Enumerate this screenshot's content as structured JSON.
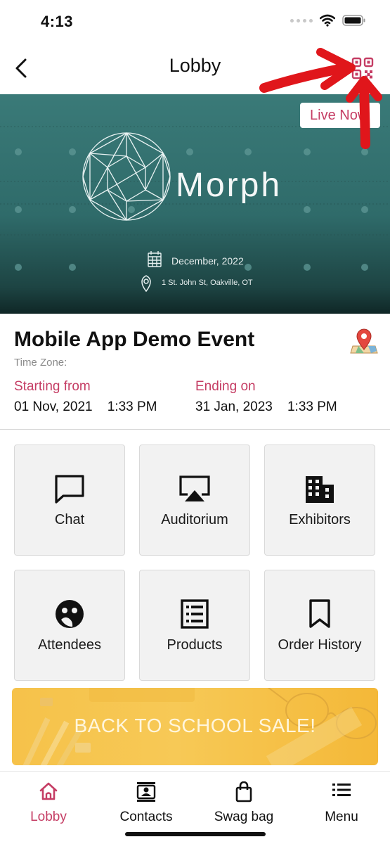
{
  "status_bar": {
    "time": "4:13"
  },
  "header": {
    "title": "Lobby"
  },
  "banner": {
    "live_badge": "Live Now",
    "logo_text": "Morph",
    "date": "December, 2022",
    "address": "1 St. John St, Oakville, OT"
  },
  "event": {
    "title": "Mobile App Demo Event",
    "timezone_label": "Time Zone:",
    "start_label": "Starting from",
    "start_value": "01 Nov, 2021    1:33 PM",
    "end_label": "Ending on",
    "end_value": "31 Jan, 2023    1:33 PM"
  },
  "tiles": [
    {
      "label": "Chat",
      "icon": "chat-icon"
    },
    {
      "label": "Auditorium",
      "icon": "airplay-icon"
    },
    {
      "label": "Exhibitors",
      "icon": "building-icon"
    },
    {
      "label": "Attendees",
      "icon": "face-icon"
    },
    {
      "label": "Products",
      "icon": "list-icon"
    },
    {
      "label": "Order History",
      "icon": "bookmark-icon"
    }
  ],
  "promo": {
    "text": "BACK TO SCHOOL SALE!"
  },
  "bottom_nav": [
    {
      "label": "Lobby",
      "icon": "home-icon",
      "active": true
    },
    {
      "label": "Contacts",
      "icon": "contact-card-icon",
      "active": false
    },
    {
      "label": "Swag bag",
      "icon": "shopping-bag-icon",
      "active": false
    },
    {
      "label": "Menu",
      "icon": "menu-icon",
      "active": false
    }
  ],
  "colors": {
    "accent": "#c53d64",
    "banner_teal": "#2f6b6a",
    "annotation_red": "#e0161b"
  }
}
